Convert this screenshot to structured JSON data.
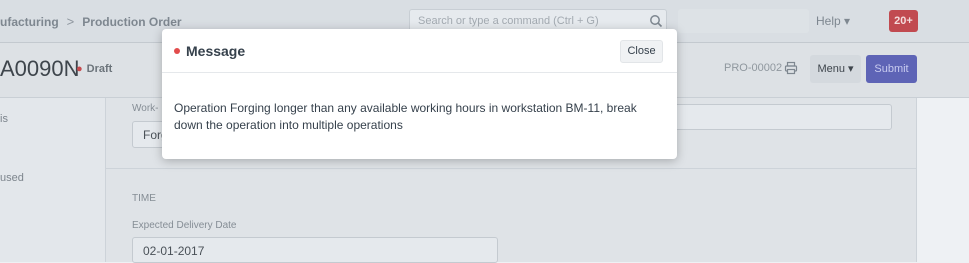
{
  "navbar": {
    "breadcrumb": [
      "ufacturing",
      "Production Order"
    ],
    "separator": ">",
    "search_placeholder": "Search or type a command (Ctrl + G)",
    "help_label": "Help ▾",
    "notification_count": "20+"
  },
  "page_head": {
    "title": "A0090N",
    "status": "Draft",
    "doc_id": "PRO-00002",
    "menu_label": "Menu ▾",
    "submit_label": "Submit"
  },
  "sidebar": {
    "items": [
      "is",
      "used"
    ]
  },
  "form": {
    "work_label": "Work-",
    "work_value": "Forg",
    "section_title": "TIME",
    "expected_label": "Expected Delivery Date",
    "expected_value": "02-01-2017"
  },
  "modal": {
    "title": "Message",
    "close_label": "Close",
    "body": "Operation Forging longer than any available working hours in workstation BM-11, break down the operation into multiple operations"
  },
  "colors": {
    "accent": "#5e64b6",
    "danger": "#e24c4c",
    "notification": "#c14a50"
  },
  "icons": [
    "search-icon",
    "print-icon",
    "status-dot-icon"
  ]
}
